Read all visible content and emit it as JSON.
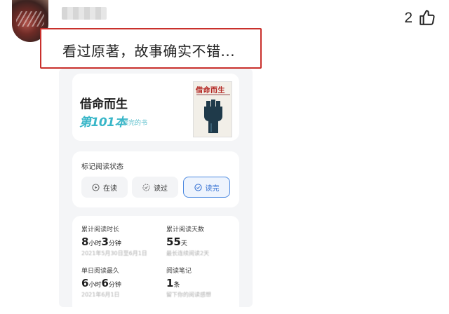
{
  "header": {
    "like_count": "2"
  },
  "comment": {
    "text": "看过原著，故事确实不错..."
  },
  "book": {
    "title": "借命而生",
    "rank": "第101本",
    "rank_suffix": "读完的书",
    "cover_title": "借命而生"
  },
  "status": {
    "label": "标记阅读状态",
    "buttons": [
      {
        "label": "在读",
        "icon": "play-circle-icon"
      },
      {
        "label": "读过",
        "icon": "dashed-circle-icon"
      },
      {
        "label": "读完",
        "icon": "check-circle-icon",
        "selected": true
      }
    ]
  },
  "stats": {
    "total_time": {
      "label": "累计阅读时长",
      "value_a": "8",
      "unit_a": "小时",
      "value_b": "3",
      "unit_b": "分钟",
      "note": "2021年5月30日至6月1日"
    },
    "total_days": {
      "label": "累计阅读天数",
      "value": "55",
      "unit": "天",
      "note": "最长连续阅读2天"
    },
    "longest_day": {
      "label": "单日阅读最久",
      "value_a": "6",
      "unit_a": "小时",
      "value_b": "6",
      "unit_b": "分钟",
      "note": "2021年6月1日"
    },
    "notes": {
      "label": "阅读笔记",
      "value": "1",
      "unit": "条",
      "note": "留下你的阅读感想"
    }
  },
  "colors": {
    "highlight_border": "#c9302c",
    "rank_color": "#38b6c8",
    "selected_accent": "#4a88e0"
  }
}
